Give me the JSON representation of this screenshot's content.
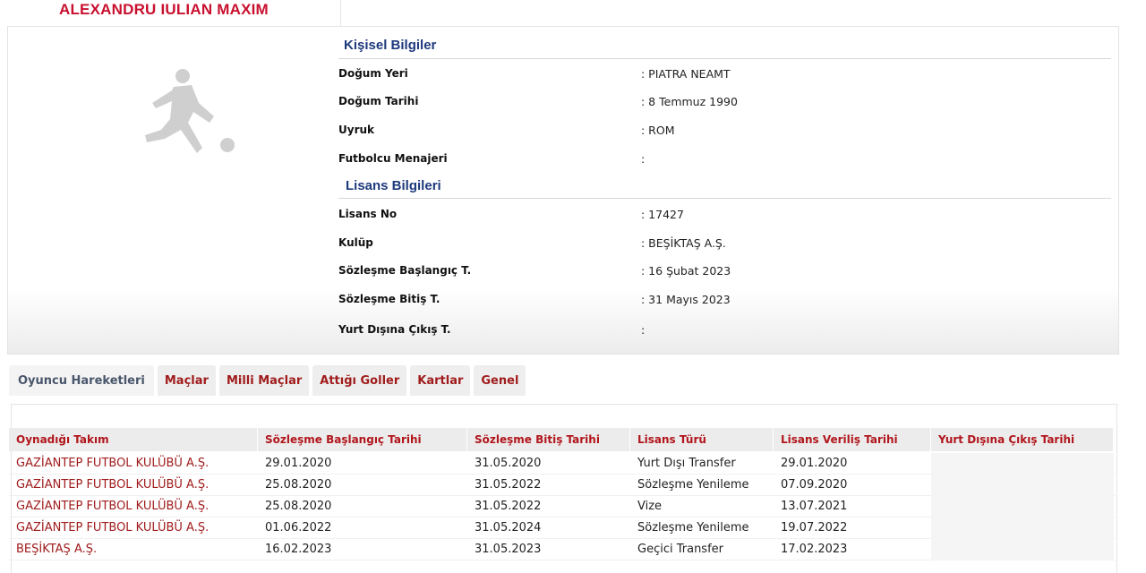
{
  "player": {
    "name": "ALEXANDRU IULIAN MAXIM"
  },
  "personal": {
    "title": "Kişisel Bilgiler",
    "fields": [
      {
        "label": "Doğum Yeri",
        "value": ":  PIATRA NEAMT"
      },
      {
        "label": "Doğum Tarihi",
        "value": ":  8 Temmuz 1990"
      },
      {
        "label": "Uyruk",
        "value": ":  ROM"
      },
      {
        "label": "Futbolcu Menajeri",
        "value": ":"
      }
    ]
  },
  "license": {
    "title": "Lisans Bilgileri",
    "fields": [
      {
        "label": "Lisans No",
        "value": ": 17427"
      },
      {
        "label": "Kulüp",
        "value": ": BEŞİKTAŞ A.Ş."
      },
      {
        "label": "Sözleşme Başlangıç T.",
        "value": ": 16 Şubat 2023"
      },
      {
        "label": "Sözleşme Bitiş T.",
        "value": ": 31 Mayıs 2023"
      },
      {
        "label": "Yurt Dışına Çıkış T.",
        "value": ":"
      }
    ]
  },
  "tabs": [
    {
      "label": "Oyuncu Hareketleri",
      "active": true
    },
    {
      "label": "Maçlar"
    },
    {
      "label": "Milli Maçlar"
    },
    {
      "label": "Attığı Goller"
    },
    {
      "label": "Kartlar"
    },
    {
      "label": "Genel"
    }
  ],
  "moves": {
    "headers": [
      "Oynadığı Takım",
      "Sözleşme Başlangıç Tarihi",
      "Sözleşme Bitiş Tarihi",
      "Lisans Türü",
      "Lisans Veriliş Tarihi",
      "Yurt Dışına Çıkış Tarihi"
    ],
    "rows": [
      [
        "GAZİANTEP FUTBOL KULÜBÜ A.Ş.",
        "29.01.2020",
        "31.05.2020",
        "Yurt Dışı Transfer",
        "29.01.2020",
        ""
      ],
      [
        "GAZİANTEP FUTBOL KULÜBÜ A.Ş.",
        "25.08.2020",
        "31.05.2022",
        "Sözleşme Yenileme",
        "07.09.2020",
        ""
      ],
      [
        "GAZİANTEP FUTBOL KULÜBÜ A.Ş.",
        "25.08.2020",
        "31.05.2022",
        "Vize",
        "13.07.2021",
        ""
      ],
      [
        "GAZİANTEP FUTBOL KULÜBÜ A.Ş.",
        "01.06.2022",
        "31.05.2024",
        "Sözleşme Yenileme",
        "19.07.2022",
        ""
      ],
      [
        "BEŞİKTAŞ A.Ş.",
        "16.02.2023",
        "31.05.2023",
        "Geçici Transfer",
        "17.02.2023",
        ""
      ]
    ]
  },
  "colors": {
    "accent_red": "#c8102e",
    "section_blue": "#1d3a7c",
    "tab_red": "#a01c1c"
  }
}
